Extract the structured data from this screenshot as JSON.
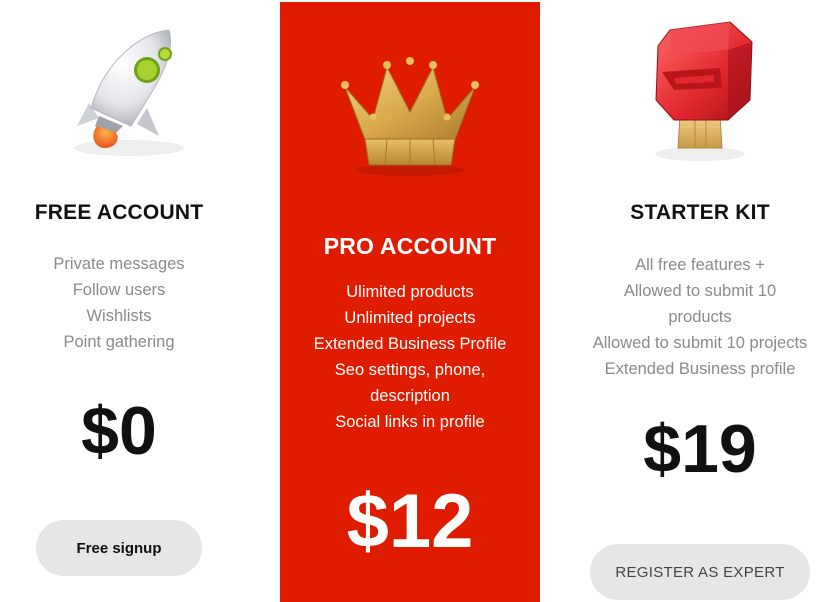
{
  "plans": [
    {
      "title": "FREE ACCOUNT",
      "icon": "rocket-icon",
      "features": [
        "Private messages",
        "Follow users",
        "Wishlists",
        "Point gathering"
      ],
      "price": "$0",
      "button_label": "Free signup"
    },
    {
      "title": "PRO ACCOUNT",
      "icon": "crown-icon",
      "features": [
        "Ulimited products",
        "Unlimited projects",
        "Extended Business Profile",
        "Seo settings, phone,",
        "description",
        "Social links in profile"
      ],
      "price": "$12",
      "accent_color": "#e01c00"
    },
    {
      "title": "STARTER KIT",
      "icon": "toolbox-icon",
      "features": [
        "All free features +",
        "Allowed to submit 10",
        "products",
        "Allowed to submit 10 projects",
        "Extended Business profile"
      ],
      "price": "$19",
      "button_label": "REGISTER AS EXPERT"
    }
  ]
}
